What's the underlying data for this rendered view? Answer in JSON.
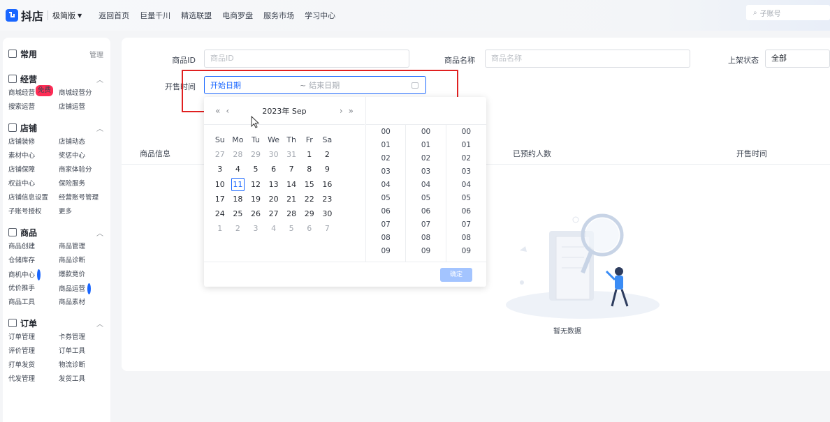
{
  "topbar": {
    "logo_mark": "⚡",
    "logo_text": "抖店",
    "edition": "极简版",
    "nav": [
      "返回首页",
      "巨量千川",
      "精选联盟",
      "电商罗盘",
      "服务市场",
      "学习中心"
    ],
    "search_placeholder": "子账号"
  },
  "sidebar": {
    "sections": [
      {
        "title": "常用",
        "right": "管理",
        "icon": "▢",
        "items": []
      },
      {
        "title": "经营",
        "right": "^",
        "icon": "▣",
        "items": [
          {
            "label": "商城经营",
            "badge": "免费"
          },
          {
            "label": "商城经营分"
          },
          {
            "label": "搜索运营"
          },
          {
            "label": "店铺运营"
          }
        ]
      },
      {
        "title": "店铺",
        "right": "^",
        "icon": "▢",
        "items": [
          {
            "label": "店铺装修"
          },
          {
            "label": "店铺动态"
          },
          {
            "label": "素材中心"
          },
          {
            "label": "奖惩中心"
          },
          {
            "label": "店铺保障"
          },
          {
            "label": "商家体验分"
          },
          {
            "label": "权益中心"
          },
          {
            "label": "保险服务"
          },
          {
            "label": "店铺信息设置"
          },
          {
            "label": "经营账号管理"
          },
          {
            "label": "子账号授权"
          },
          {
            "label": "更多"
          }
        ]
      },
      {
        "title": "商品",
        "right": "^",
        "icon": "▢",
        "items": [
          {
            "label": "商品创建"
          },
          {
            "label": "商品管理"
          },
          {
            "label": "仓储库存"
          },
          {
            "label": "商品诊断"
          },
          {
            "label": "商机中心",
            "dot": true
          },
          {
            "label": "爆款竞价"
          },
          {
            "label": "优价推手"
          },
          {
            "label": "商品运营",
            "dot": true
          },
          {
            "label": "商品工具"
          },
          {
            "label": "商品素材"
          }
        ]
      },
      {
        "title": "订单",
        "right": "^",
        "icon": "▢",
        "items": [
          {
            "label": "订单管理"
          },
          {
            "label": "卡券管理"
          },
          {
            "label": "评价管理"
          },
          {
            "label": "订单工具"
          },
          {
            "label": "打单发货"
          },
          {
            "label": "物流诊断"
          },
          {
            "label": "代发管理"
          },
          {
            "label": "发货工具"
          }
        ]
      }
    ]
  },
  "filters": {
    "product_id_label": "商品ID",
    "product_id_placeholder": "商品ID",
    "product_name_label": "商品名称",
    "product_name_placeholder": "商品名称",
    "status_label": "上架状态",
    "status_value": "全部",
    "sale_time_label": "开售时间",
    "start_placeholder": "开始日期",
    "tilde": "~",
    "end_placeholder": "结束日期"
  },
  "table": {
    "columns": [
      "商品信息",
      "已预约人数",
      "开售时间"
    ],
    "empty_text": "暂无数据"
  },
  "picker": {
    "nav_prev_year": "«",
    "nav_prev_month": "‹",
    "month_label": "2023年 Sep",
    "nav_next_month": "›",
    "nav_next_year": "»",
    "weekdays": [
      "Su",
      "Mo",
      "Tu",
      "We",
      "Th",
      "Fr",
      "Sa"
    ],
    "days": [
      {
        "d": "27",
        "other": true
      },
      {
        "d": "28",
        "other": true
      },
      {
        "d": "29",
        "other": true
      },
      {
        "d": "30",
        "other": true
      },
      {
        "d": "31",
        "other": true
      },
      {
        "d": "1"
      },
      {
        "d": "2"
      },
      {
        "d": "3"
      },
      {
        "d": "4"
      },
      {
        "d": "5"
      },
      {
        "d": "6"
      },
      {
        "d": "7"
      },
      {
        "d": "8"
      },
      {
        "d": "9"
      },
      {
        "d": "10"
      },
      {
        "d": "11",
        "today": true
      },
      {
        "d": "12"
      },
      {
        "d": "13"
      },
      {
        "d": "14"
      },
      {
        "d": "15"
      },
      {
        "d": "16"
      },
      {
        "d": "17"
      },
      {
        "d": "18"
      },
      {
        "d": "19"
      },
      {
        "d": "20"
      },
      {
        "d": "21"
      },
      {
        "d": "22"
      },
      {
        "d": "23"
      },
      {
        "d": "24"
      },
      {
        "d": "25"
      },
      {
        "d": "26"
      },
      {
        "d": "27"
      },
      {
        "d": "28"
      },
      {
        "d": "29"
      },
      {
        "d": "30"
      },
      {
        "d": "1",
        "other": true
      },
      {
        "d": "2",
        "other": true
      },
      {
        "d": "3",
        "other": true
      },
      {
        "d": "4",
        "other": true
      },
      {
        "d": "5",
        "other": true
      },
      {
        "d": "6",
        "other": true
      },
      {
        "d": "7",
        "other": true
      }
    ],
    "time_values": [
      "00",
      "01",
      "02",
      "03",
      "04",
      "05",
      "06",
      "07",
      "08",
      "09"
    ],
    "ok_label": "确定"
  },
  "colors": {
    "accent": "#1966ff",
    "highlight": "#e02020"
  }
}
